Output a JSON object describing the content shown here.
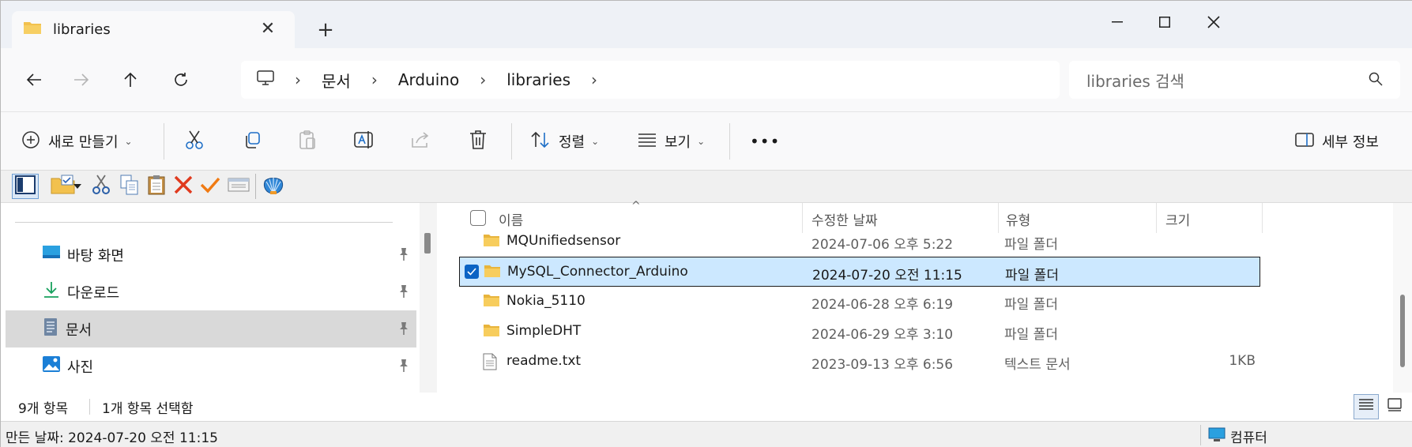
{
  "tab": {
    "title": "libraries"
  },
  "breadcrumb": [
    "문서",
    "Arduino",
    "libraries"
  ],
  "search": {
    "placeholder": "libraries 검색"
  },
  "commandbar": {
    "new_label": "새로 만들기",
    "sort_label": "정렬",
    "view_label": "보기",
    "more_label": "•••",
    "details_label": "세부 정보"
  },
  "navpane": {
    "items": [
      {
        "label": "바탕 화면",
        "icon": "desktop-icon"
      },
      {
        "label": "다운로드",
        "icon": "download-icon"
      },
      {
        "label": "문서",
        "icon": "documents-icon",
        "selected": true
      },
      {
        "label": "사진",
        "icon": "pictures-icon"
      }
    ]
  },
  "columns": {
    "name": "이름",
    "date": "수정한 날짜",
    "type": "유형",
    "size": "크기"
  },
  "files": [
    {
      "name": "MQUnifiedsensor",
      "date": "2024-07-06 오후 5:22",
      "type": "파일 폴더",
      "size": "",
      "icon": "folder-icon"
    },
    {
      "name": "MySQL_Connector_Arduino",
      "date": "2024-07-20 오전 11:15",
      "type": "파일 폴더",
      "size": "",
      "icon": "folder-icon",
      "selected": true
    },
    {
      "name": "Nokia_5110",
      "date": "2024-06-28 오후 6:19",
      "type": "파일 폴더",
      "size": "",
      "icon": "folder-icon"
    },
    {
      "name": "SimpleDHT",
      "date": "2024-06-29 오후 3:10",
      "type": "파일 폴더",
      "size": "",
      "icon": "folder-icon"
    },
    {
      "name": "readme.txt",
      "date": "2023-09-13 오후 6:56",
      "type": "텍스트 문서",
      "size": "1KB",
      "icon": "text-file-icon"
    }
  ],
  "status": {
    "count": "9개 항목",
    "selected": "1개 항목 선택함"
  },
  "legacy_status": {
    "created": "만든 날짜: 2024-07-20 오전 11:15",
    "location": "컴퓨터"
  },
  "colors": {
    "folder": "#f2c14e",
    "accent": "#0b63c4",
    "selection": "#cce8ff"
  }
}
